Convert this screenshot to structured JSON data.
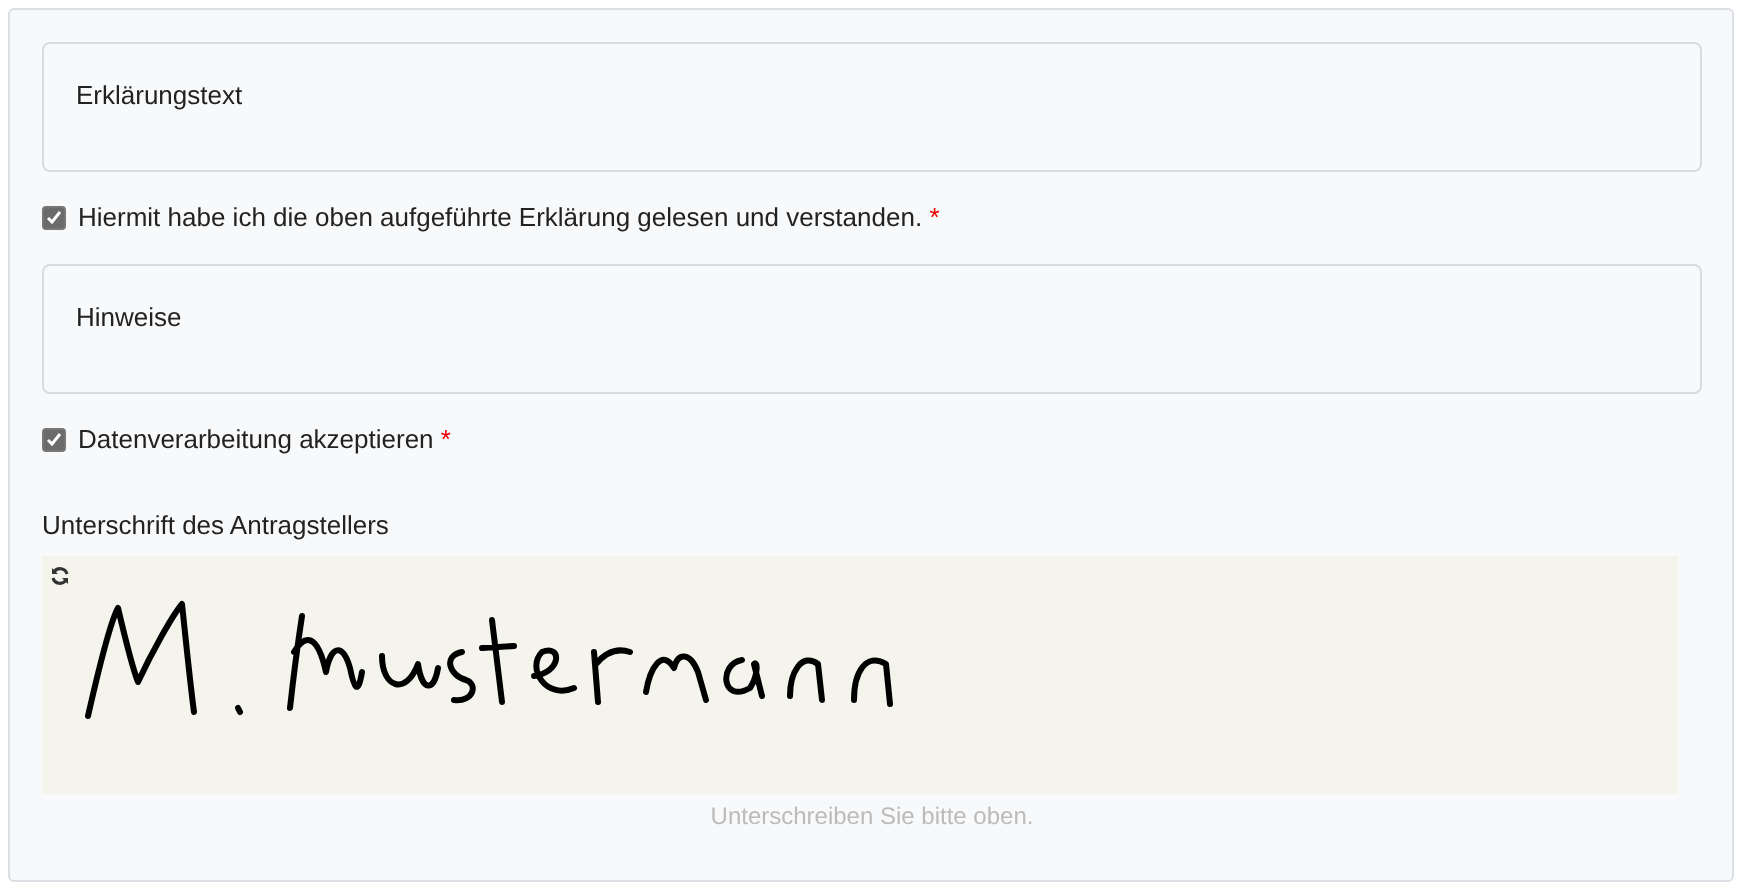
{
  "sections": [
    {
      "kind": "textbox",
      "text": "Erklärungstext"
    },
    {
      "kind": "checkbox",
      "label": "Hiermit habe ich die oben aufgeführte Erklärung gelesen und verstanden.",
      "required": "*",
      "checked": true
    },
    {
      "kind": "textbox",
      "text": "Hinweise"
    },
    {
      "kind": "checkbox",
      "label": "Datenverarbeitung akzeptieren",
      "required": "*",
      "checked": true
    }
  ],
  "signature": {
    "label": "Unterschrift des Antragstellers",
    "hint": "Unterschreiben Sie bitte oben.",
    "signed": true
  }
}
